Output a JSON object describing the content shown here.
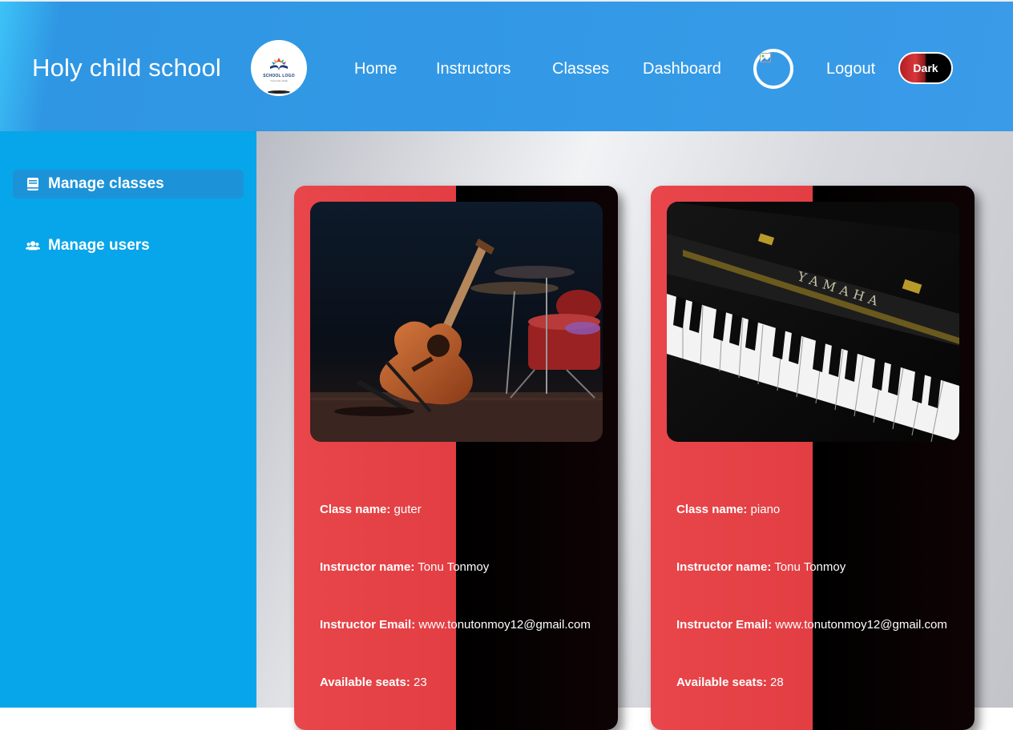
{
  "header": {
    "site_title": "Holy child school",
    "logo_text": "SCHOOL LOGO",
    "logo_subtext": "TAGLINE HERE",
    "nav": [
      {
        "label": "Home"
      },
      {
        "label": "Instructors"
      },
      {
        "label": "Classes"
      },
      {
        "label": "Dashboard"
      }
    ],
    "logout_label": "Logout",
    "theme_toggle_label": "Dark"
  },
  "sidebar": {
    "items": [
      {
        "label": "Manage classes",
        "icon": "book-icon",
        "active": true
      },
      {
        "label": "Manage users",
        "icon": "users-icon",
        "active": false
      }
    ]
  },
  "labels": {
    "class_name": "Class name:",
    "instructor_name": "Instructor name:",
    "instructor_email": "Instructor Email:",
    "available_seats": "Available seats:"
  },
  "classes": [
    {
      "class_name": "guter",
      "instructor_name": "Tonu Tonmoy",
      "instructor_email": "www.tonutonmoy12@gmail.com",
      "available_seats": "23",
      "image": "guitar-and-drums-photo"
    },
    {
      "class_name": "piano",
      "instructor_name": "Tonu Tonmoy",
      "instructor_email": "www.tonutonmoy12@gmail.com",
      "available_seats": "28",
      "image": "yamaha-piano-keys-photo"
    }
  ],
  "colors": {
    "header_bg": "#3399e6",
    "sidebar_bg": "#07a5e9",
    "card_red": "#e8464a",
    "card_black": "#000000"
  }
}
